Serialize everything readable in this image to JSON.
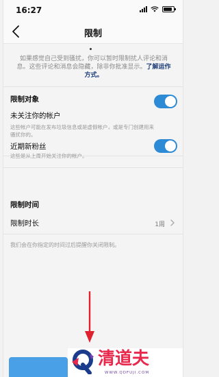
{
  "status_bar": {
    "time": "16:27"
  },
  "nav": {
    "title": "限制"
  },
  "intro": {
    "text": "如果感觉自己受到骚扰，你可以暂时限制扰人评论和消息。这些评论和消息会隐藏，除非你批准显示。",
    "link": "了解运作方式。"
  },
  "restrict_targets": {
    "header": "限制对象",
    "items": [
      {
        "title": "未关注你的帐户",
        "description": "这些帐户可能在发布垃圾信息或是虚假帐户，或是专门创建用来骚扰你的。",
        "enabled": true
      },
      {
        "title": "近期新粉丝",
        "description": "这些是从上周开始关注你的帐户。",
        "enabled": true
      }
    ]
  },
  "restrict_time": {
    "header": "限制时间",
    "row_label": "限制时长",
    "row_value": "1周",
    "note": "我们会在你指定的时间过后提醒你关闭限制。"
  },
  "colors": {
    "toggle_on": "#2d8bd6",
    "link": "#1f3f7a",
    "arrow": "#e0202e",
    "watermark": "#e8274b"
  },
  "watermark": {
    "brand": "清道夫",
    "url": "WWW.QDFUJI.COM"
  }
}
